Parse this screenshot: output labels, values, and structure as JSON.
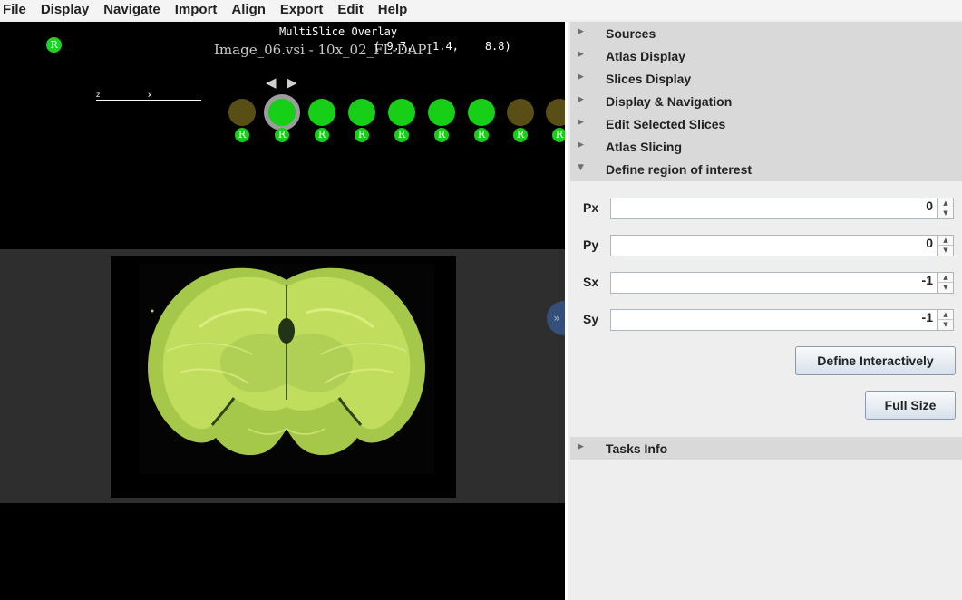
{
  "menu": [
    "File",
    "Display",
    "Navigate",
    "Import",
    "Align",
    "Export",
    "Edit",
    "Help"
  ],
  "viewer": {
    "title": "MultiSlice Overlay",
    "image_name": "Image_06.vsi - 10x_02_FL-DAPI",
    "coordinates": "( 9.7,   1.4,    8.8)",
    "registration_glyph": "R",
    "scale_z": "z",
    "scale_x": "x",
    "nav_left": "◀",
    "nav_right": "▶",
    "slices": [
      {
        "state": "inactive",
        "badge": "R"
      },
      {
        "state": "selected",
        "badge": "R"
      },
      {
        "state": "active",
        "badge": "R"
      },
      {
        "state": "active",
        "badge": "R"
      },
      {
        "state": "active",
        "badge": "R"
      },
      {
        "state": "active",
        "badge": "R"
      },
      {
        "state": "active",
        "badge": "R"
      },
      {
        "state": "inactive",
        "badge": "R"
      },
      {
        "state": "inactive",
        "badge": "R"
      }
    ],
    "collapse_glyph": "»"
  },
  "side_panel": {
    "sections": [
      {
        "label": "Sources",
        "arrow": "▶"
      },
      {
        "label": "Atlas Display",
        "arrow": "▶"
      },
      {
        "label": "Slices Display",
        "arrow": "▶"
      },
      {
        "label": "Display & Navigation",
        "arrow": "▶"
      },
      {
        "label": "Edit Selected Slices",
        "arrow": "▶"
      },
      {
        "label": "Atlas Slicing",
        "arrow": "▶"
      },
      {
        "label": "Define region of interest",
        "arrow": "▼"
      }
    ],
    "roi": {
      "fields": [
        {
          "label": "Px",
          "value": "0"
        },
        {
          "label": "Py",
          "value": "0"
        },
        {
          "label": "Sx",
          "value": "-1"
        },
        {
          "label": "Sy",
          "value": "-1"
        }
      ],
      "spin_up": "▲",
      "spin_down": "▼",
      "define_interactively": "Define Interactively",
      "full_size": "Full Size"
    },
    "tasks": {
      "label": "Tasks Info",
      "arrow": "▶"
    }
  }
}
